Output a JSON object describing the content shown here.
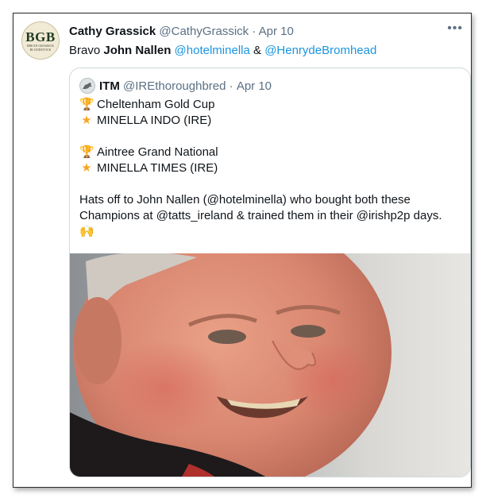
{
  "tweet": {
    "author_name": "Cathy Grassick",
    "author_handle": "@CathyGrassick",
    "separator": "·",
    "date": "Apr 10",
    "more": "•••",
    "text_prefix": "Bravo ",
    "text_bold": "John Nallen",
    "mention_1": "@hotelminella",
    "ampersand": "&",
    "mention_2": "@HenrydeBromhead",
    "avatar": {
      "monogram": "BGB",
      "caption": "BREAN GRASSICK BLOODSTOCK"
    }
  },
  "quoted": {
    "author_name": "ITM",
    "author_handle": "@IREthoroughbred",
    "separator": "·",
    "date": "Apr 10",
    "lines": [
      {
        "icon": "trophy-icon",
        "text": "Cheltenham Gold Cup"
      },
      {
        "icon": "star-icon",
        "text": "MINELLA INDO (IRE)"
      },
      {
        "icon": "trophy-icon",
        "text": "Aintree Grand National"
      },
      {
        "icon": "star-icon",
        "text": "MINELLA TIMES (IRE)"
      }
    ],
    "paragraph_1": "Hats off to John Nallen (@hotelminella) who bought both these",
    "paragraph_2": "Champions at @tatts_ireland & trained them in their @irishp2p days.",
    "raised_hands": "🙌"
  },
  "colors": {
    "link": "#1b95e0",
    "muted": "#5b7083",
    "border": "#cfd9de"
  }
}
